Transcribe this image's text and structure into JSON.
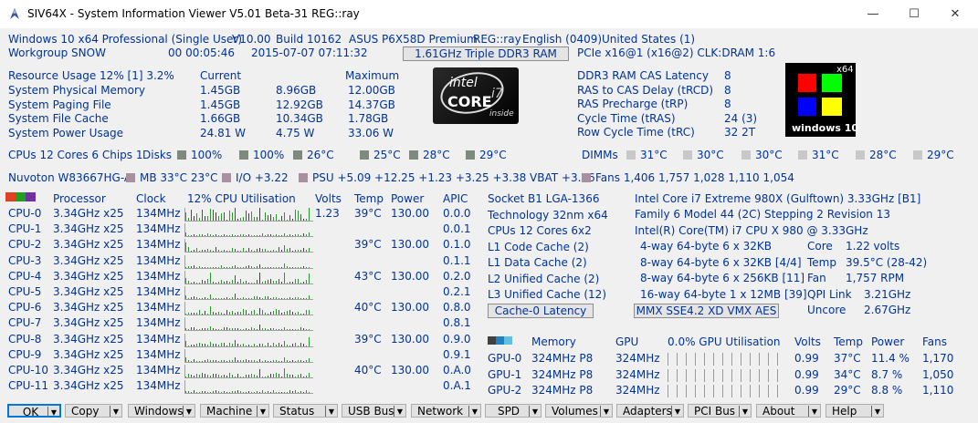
{
  "window": {
    "title": "SIV64X - System Information Viewer V5.01 Beta-31 REG::ray",
    "minimize": "—",
    "maximize": "☐",
    "close": "✕"
  },
  "sysinfo": {
    "os": "Windows 10 x64 Professional (Single User)",
    "version": "V10.00",
    "build": "Build 10162",
    "board": "ASUS P6X58D Premium",
    "reg": "REG::ray",
    "lang": "English (0409)",
    "country": "United States (1)",
    "workgroup": "Workgroup SNOW",
    "uptime": "00 00:05:46",
    "datetime": "2015-07-07 07:11:32",
    "memory_button": "1.61GHz Triple DDR3 RAM",
    "pcie": "PCIe x16@1 (x16@2) CLK:DRAM 1:6"
  },
  "resource": {
    "header": "Resource Usage 12% [1] 3.2%",
    "current_label": "Current",
    "maximum_label": "Maximum",
    "rows": [
      {
        "label": "System Physical Memory",
        "current": "1.45GB",
        "mid": "8.96GB",
        "max": "12.00GB"
      },
      {
        "label": "System Paging File",
        "current": "1.45GB",
        "mid": "12.92GB",
        "max": "14.37GB"
      },
      {
        "label": "System File Cache",
        "current": "1.66GB",
        "mid": "10.34GB",
        "max": "1.78GB"
      },
      {
        "label": "System Power Usage",
        "current": "24.81 W",
        "mid": "4.75 W",
        "max": "33.06 W"
      }
    ]
  },
  "intel_logo": {
    "brand": "intel",
    "core": "CORE",
    "i7": "i7",
    "inside": "inside"
  },
  "ram_timings": [
    {
      "label": "DDR3 RAM CAS Latency",
      "value": "8"
    },
    {
      "label": "RAS to CAS Delay (tRCD)",
      "value": "8"
    },
    {
      "label": "RAS Precharge (tRP)",
      "value": "8"
    },
    {
      "label": "Cycle Time (tRAS)",
      "value": "24 (3)"
    },
    {
      "label": "Row Cycle Time (tRC)",
      "value": "32 2T"
    }
  ],
  "win_logo": {
    "x64": "x64",
    "text": "windows 10"
  },
  "disks": {
    "cpus": "CPUs 12 Cores 6 Chips 1",
    "label": "Disks",
    "values": [
      "100%",
      "100%",
      "26°C",
      "25°C",
      "28°C",
      "29°C"
    ]
  },
  "dimms": {
    "label": "DIMMs",
    "values": [
      "31°C",
      "30°C",
      "30°C",
      "31°C",
      "28°C",
      "29°C"
    ]
  },
  "sensors": {
    "chip": "Nuvoton W83667HG-A",
    "mb": "MB 33°C 23°C",
    "io": "I/O +3.22",
    "psu": "PSU +5.09 +12.25 +1.23 +3.25 +3.38 VBAT +3.26",
    "fans": "Fans 1,406 1,757 1,028 1,110 1,054"
  },
  "cpu_table": {
    "headers": {
      "processor": "Processor",
      "clock": "Clock",
      "util": "12% CPU Utilisation",
      "volts": "Volts",
      "temp": "Temp",
      "power": "Power",
      "apic": "APIC"
    },
    "rows": [
      {
        "name": "CPU-0",
        "speed": "3.34GHz x25",
        "clock": "134MHz",
        "volts": "1.23",
        "temp": "39°C",
        "power": "130.00",
        "apic": "0.0.0",
        "util": 0.9
      },
      {
        "name": "CPU-1",
        "speed": "3.34GHz x25",
        "clock": "134MHz",
        "volts": "",
        "temp": "",
        "power": "",
        "apic": "0.0.1",
        "util": 0.2
      },
      {
        "name": "CPU-2",
        "speed": "3.34GHz x25",
        "clock": "134MHz",
        "volts": "",
        "temp": "39°C",
        "power": "130.00",
        "apic": "0.1.0",
        "util": 0.35
      },
      {
        "name": "CPU-3",
        "speed": "3.34GHz x25",
        "clock": "134MHz",
        "volts": "",
        "temp": "",
        "power": "",
        "apic": "0.1.1",
        "util": 0.2
      },
      {
        "name": "CPU-4",
        "speed": "3.34GHz x25",
        "clock": "134MHz",
        "volts": "",
        "temp": "43°C",
        "power": "130.00",
        "apic": "0.2.0",
        "util": 0.4
      },
      {
        "name": "CPU-5",
        "speed": "3.34GHz x25",
        "clock": "134MHz",
        "volts": "",
        "temp": "",
        "power": "",
        "apic": "0.2.1",
        "util": 0.2
      },
      {
        "name": "CPU-6",
        "speed": "3.34GHz x25",
        "clock": "134MHz",
        "volts": "",
        "temp": "40°C",
        "power": "130.00",
        "apic": "0.8.0",
        "util": 0.4
      },
      {
        "name": "CPU-7",
        "speed": "3.34GHz x25",
        "clock": "134MHz",
        "volts": "",
        "temp": "",
        "power": "",
        "apic": "0.8.1",
        "util": 0.2
      },
      {
        "name": "CPU-8",
        "speed": "3.34GHz x25",
        "clock": "134MHz",
        "volts": "",
        "temp": "39°C",
        "power": "130.00",
        "apic": "0.9.0",
        "util": 0.35
      },
      {
        "name": "CPU-9",
        "speed": "3.34GHz x25",
        "clock": "134MHz",
        "volts": "",
        "temp": "",
        "power": "",
        "apic": "0.9.1",
        "util": 0.2
      },
      {
        "name": "CPU-10",
        "speed": "3.34GHz x25",
        "clock": "134MHz",
        "volts": "",
        "temp": "40°C",
        "power": "130.00",
        "apic": "0.A.0",
        "util": 0.35
      },
      {
        "name": "CPU-11",
        "speed": "3.34GHz x25",
        "clock": "134MHz",
        "volts": "",
        "temp": "",
        "power": "",
        "apic": "0.A.1",
        "util": 0.2
      }
    ]
  },
  "cpu_details": {
    "left": [
      "Socket B1 LGA-1366",
      "Technology 32nm  x64",
      "CPUs 12 Cores 6x2",
      "L1 Code Cache (2)",
      "L1 Data Cache (2)",
      "L2 Unified Cache (2)",
      "L3 Unified Cache (12)"
    ],
    "latency_button": "Cache-0 Latency",
    "model": "Intel Core i7 Extreme 980X (Gulftown) 3.33GHz [B1]",
    "family": "Family 6  Model 44 (2C)  Stepping 2  Revision 13",
    "brand": "Intel(R) Core(TM) i7 CPU X 980 @ 3.33GHz",
    "caches": [
      "4-way 64-byte  6 x 32KB",
      "8-way 64-byte  6 x 32KB [4/4]",
      "8-way 64-byte  6 x 256KB [11]",
      "16-way 64-byte  1 x 12MB [39]"
    ],
    "stats": [
      {
        "label": "Core",
        "value": "1.22 volts"
      },
      {
        "label": "Temp",
        "value": "39.5°C (28-42)"
      },
      {
        "label": "Fan",
        "value": "1,757 RPM"
      },
      {
        "label": "QPI Link",
        "value": "3.21GHz"
      },
      {
        "label": "Uncore",
        "value": "2.67GHz"
      }
    ],
    "features_button": "MMX SSE4.2 XD VMX AES"
  },
  "gpu_table": {
    "headers": {
      "memory": "Memory",
      "gpu": "GPU",
      "util": "0.0% GPU Utilisation",
      "volts": "Volts",
      "temp": "Temp",
      "power": "Power",
      "fans": "Fans"
    },
    "rows": [
      {
        "name": "GPU-0",
        "memory": "324MHz P8",
        "gpu": "324MHz",
        "volts": "0.99",
        "temp": "37°C",
        "power": "11.4 %",
        "fans": "1,170"
      },
      {
        "name": "GPU-1",
        "memory": "324MHz P8",
        "gpu": "324MHz",
        "volts": "0.99",
        "temp": "34°C",
        "power": "8.7 %",
        "fans": "1,050"
      },
      {
        "name": "GPU-2",
        "memory": "324MHz P8",
        "gpu": "324MHz",
        "volts": "0.99",
        "temp": "29°C",
        "power": "8.8 %",
        "fans": "1,110"
      }
    ]
  },
  "buttons": [
    "OK",
    "Copy",
    "Windows",
    "Machine",
    "Status",
    "USB Bus",
    "Network",
    "SPD",
    "Volumes",
    "Adapters",
    "PCI Bus",
    "About",
    "Help"
  ],
  "colors": {
    "text": "#003399",
    "accent": "#0078d7"
  }
}
